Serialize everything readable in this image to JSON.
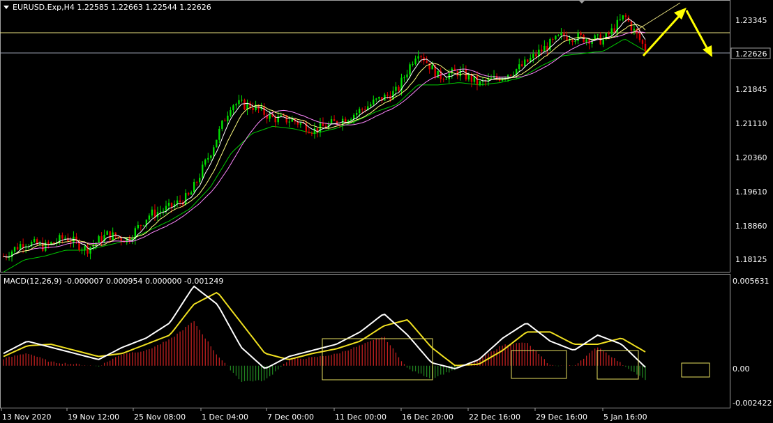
{
  "header": {
    "symbol_line": "EURUSD.Exp,H4  1.22585 1.22663 1.22544 1.22626",
    "macd_line": "MACD(12,26,9) -0.000007 0.000954 0.000000 -0.001249"
  },
  "price_scale": {
    "ticks": [
      "1.23345",
      "1.22626",
      "1.21845",
      "1.21110",
      "1.20360",
      "1.19610",
      "1.18860",
      "1.18125"
    ],
    "current_price": "1.22626"
  },
  "macd_scale": {
    "ticks": [
      "0.005631",
      "0.00",
      "-0.002422"
    ]
  },
  "time_axis": {
    "labels": [
      "13 Nov 2020",
      "19 Nov 12:00",
      "25 Nov 08:00",
      "1 Dec 04:00",
      "7 Dec 00:00",
      "11 Dec 00:00",
      "16 Dec 20:00",
      "22 Dec 16:00",
      "29 Dec 16:00",
      "5 Jan 16:00"
    ]
  },
  "colors": {
    "background": "#000000",
    "bull": "#00e000",
    "bear": "#e00000",
    "ma_green": "#00cc00",
    "ma_pink": "#ff88ff",
    "ma_white": "#ffffff",
    "ma_yellow": "#ffff80",
    "macd_white": "#ffffff",
    "signal_yellow": "#f0e020",
    "hist_pos": "#c02020",
    "hist_neg": "#208020",
    "arrow": "#ffff00",
    "hline": "#e8e080",
    "box": "#e8e060"
  },
  "chart_data": [
    {
      "type": "line",
      "title": "EURUSD.Exp,H4",
      "x": [
        0,
        10,
        20,
        30,
        40,
        50,
        60,
        70,
        80,
        90,
        100,
        110,
        120,
        130,
        140,
        150,
        160,
        170,
        180,
        190,
        200,
        210,
        220,
        230
      ],
      "series": [
        {
          "values": [
            1.1835,
            1.1865,
            1.1855,
            1.1875,
            1.185,
            1.188,
            1.187,
            1.192,
            1.1935,
            1.196,
            1.205,
            1.215,
            1.2145,
            1.212,
            1.2115,
            1.2095,
            1.211,
            1.213,
            1.2155,
            1.2175,
            1.226,
            1.2205,
            1.2215,
            1.219,
            1.2205,
            1.2225,
            1.226,
            1.229,
            1.2285,
            1.228,
            1.233,
            1.2262
          ]
        },
        {
          "values": [
            1.1815,
            1.184,
            1.1848,
            1.186,
            1.186,
            1.187,
            1.188,
            1.19,
            1.192,
            1.1945,
            1.199,
            1.206,
            1.21,
            1.2115,
            1.211,
            1.21,
            1.211,
            1.2125,
            1.2145,
            1.216,
            1.22,
            1.22,
            1.2205,
            1.22,
            1.2205,
            1.2215,
            1.224,
            1.226,
            1.2265,
            1.227,
            1.2295,
            1.227
          ]
        }
      ],
      "ylim": [
        1.1805,
        1.236
      ]
    },
    {
      "type": "line",
      "title": "MACD(12,26,9)",
      "series": [
        {
          "values": [
            0.0008,
            0.0016,
            0.0012,
            0.0008,
            0.0004,
            0.0012,
            0.0018,
            0.0028,
            0.0052,
            0.004,
            0.0012,
            -0.0002,
            0.0006,
            0.001,
            0.0014,
            0.0022,
            0.0034,
            0.002,
            0.0002,
            -0.0002,
            0.0004,
            0.0018,
            0.0028,
            0.0016,
            0.001,
            0.002,
            0.0014,
            -0.0001
          ]
        },
        {
          "values": [
            0.0006,
            0.0013,
            0.0014,
            0.001,
            0.0006,
            0.0008,
            0.0014,
            0.002,
            0.004,
            0.0048,
            0.0028,
            0.0008,
            0.0004,
            0.0008,
            0.0011,
            0.0016,
            0.0026,
            0.003,
            0.0012,
            0.0,
            0.0001,
            0.001,
            0.0022,
            0.0022,
            0.0014,
            0.0014,
            0.0018,
            0.0009
          ]
        }
      ],
      "ylim": [
        -0.002422,
        0.005631
      ]
    }
  ]
}
